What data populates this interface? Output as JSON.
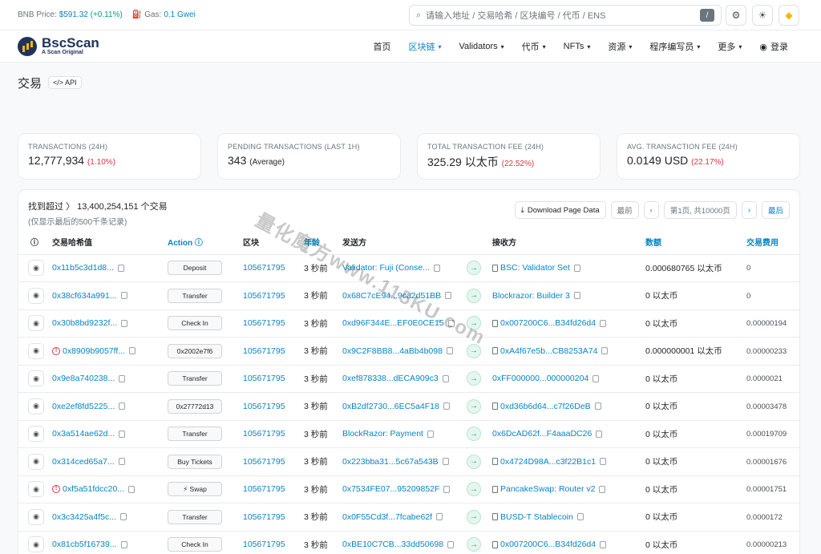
{
  "topbar": {
    "bnb_label": "BNB Price:",
    "bnb_price": "$591.32",
    "bnb_change": "(+0.11%)",
    "gas_label": "Gas:",
    "gas_value": "0.1 Gwei",
    "search_placeholder": "请输入地址 / 交易哈希 / 区块编号 / 代币 / ENS",
    "search_shortcut": "/"
  },
  "nav": {
    "logo_name": "BscScan",
    "logo_sub": "A Scan Original",
    "items": [
      {
        "label": "首页",
        "dropdown": false
      },
      {
        "label": "区块链",
        "dropdown": true,
        "active": true
      },
      {
        "label": "Validators",
        "dropdown": true
      },
      {
        "label": "代币",
        "dropdown": true
      },
      {
        "label": "NFTs",
        "dropdown": true
      },
      {
        "label": "资源",
        "dropdown": true
      },
      {
        "label": "程序编写员",
        "dropdown": true
      },
      {
        "label": "更多",
        "dropdown": true
      }
    ],
    "login": "登录"
  },
  "page": {
    "title": "交易",
    "api_label": "API"
  },
  "stats": [
    {
      "label": "TRANSACTIONS (24H)",
      "value": "12,777,934",
      "extra": "(1.10%)"
    },
    {
      "label": "PENDING TRANSACTIONS (LAST 1H)",
      "value": "343",
      "extra": "(Average)"
    },
    {
      "label": "TOTAL TRANSACTION FEE (24H)",
      "value": "325.29 以太币",
      "extra": "(22.52%)"
    },
    {
      "label": "AVG. TRANSACTION FEE (24H)",
      "value": "0.0149 USD",
      "extra": "(22.17%)"
    }
  ],
  "table": {
    "found": "找到超过 〉 13,400,254,151 个交易",
    "sub": "(仅显示最后的500千条记录)",
    "download": "Download Page Data",
    "first": "最前",
    "prev": "‹",
    "page": "第1页, 共10000页",
    "next": "›",
    "last": "最后",
    "headers": {
      "hash": "交易哈希值",
      "action": "Action",
      "block": "区块",
      "age": "年龄",
      "from": "发送方",
      "to": "接收方",
      "amount": "数额",
      "fee": "交易费用"
    },
    "rows": [
      {
        "hash": "0x11b5c3d1d8...",
        "error": false,
        "action": "Deposit",
        "block": "105671795",
        "age": "3 秒前",
        "from": "Validator: Fuji (Conse...",
        "to": "BSC: Validator Set",
        "to_contract": true,
        "amount": "0.000680765 以太币",
        "fee": "0"
      },
      {
        "hash": "0x38cf634a991...",
        "error": false,
        "action": "Transfer",
        "block": "105671795",
        "age": "3 秒前",
        "from": "0x68C7cE94...9ca2d51BB",
        "to": "Blockrazor: Builder 3",
        "to_contract": false,
        "amount": "0 以太币",
        "fee": "0"
      },
      {
        "hash": "0x30b8bd9232f...",
        "error": false,
        "action": "Check In",
        "block": "105671795",
        "age": "3 秒前",
        "from": "0xd96F344E...EF0E0CE15",
        "to": "0x007200C6...B34fd26d4",
        "to_contract": true,
        "amount": "0 以太币",
        "fee": "0.00000194"
      },
      {
        "hash": "0x8909b9057ff...",
        "error": true,
        "action": "0x2002e7f6",
        "block": "105671795",
        "age": "3 秒前",
        "from": "0x9C2F8BB8...4aBb4b098",
        "to": "0xA4f67e5b...CB8253A74",
        "to_contract": true,
        "amount": "0.000000001 以太币",
        "fee": "0.00000233"
      },
      {
        "hash": "0x9e8a740238...",
        "error": false,
        "action": "Transfer",
        "block": "105671795",
        "age": "3 秒前",
        "from": "0xef878338...dECA909c3",
        "to": "0xFF000000...000000204",
        "to_contract": false,
        "amount": "0 以太币",
        "fee": "0.0000021"
      },
      {
        "hash": "0xe2ef8fd5225...",
        "error": false,
        "action": "0x27772d13",
        "block": "105671795",
        "age": "3 秒前",
        "from": "0xB2df2730...6EC5a4F18",
        "to": "0xd36b6d64...c7f26DeB",
        "to_contract": true,
        "amount": "0 以太币",
        "fee": "0.00003478"
      },
      {
        "hash": "0x3a514ae62d...",
        "error": false,
        "action": "Transfer",
        "block": "105671795",
        "age": "3 秒前",
        "from": "BlockRazor: Payment",
        "to": "0x6DcAD62f...F4aaaDC26",
        "to_contract": false,
        "amount": "0 以太币",
        "fee": "0.00019709"
      },
      {
        "hash": "0x314ced65a7...",
        "error": false,
        "action": "Buy Tickets",
        "block": "105671795",
        "age": "3 秒前",
        "from": "0x223bba31...5c67a543B",
        "to": "0x4724D98A...c3f22B1c1",
        "to_contract": true,
        "amount": "0 以太币",
        "fee": "0.00001676"
      },
      {
        "hash": "0xf5a51fdcc20...",
        "error": true,
        "action": "⚡ Swap",
        "block": "105671795",
        "age": "3 秒前",
        "from": "0x7534FE07...95209852F",
        "to": "PancakeSwap: Router v2",
        "to_contract": true,
        "amount": "0 以太币",
        "fee": "0.00001751"
      },
      {
        "hash": "0x3c3425a4f5c...",
        "error": false,
        "action": "Transfer",
        "block": "105671795",
        "age": "3 秒前",
        "from": "0x0F55Cd3f...7fcabe62f",
        "to": "BUSD-T Stablecoin",
        "to_contract": true,
        "amount": "0 以太币",
        "fee": "0.0000172"
      },
      {
        "hash": "0x81cb5f16739...",
        "error": false,
        "action": "Check In",
        "block": "105671795",
        "age": "3 秒前",
        "from": "0xBE10C7CB...33dd50698",
        "to": "0x007200C6...B34fd26d4",
        "to_contract": true,
        "amount": "0 以太币",
        "fee": "0.00000213"
      }
    ]
  },
  "watermark": "量化魔方www.115KU.com"
}
